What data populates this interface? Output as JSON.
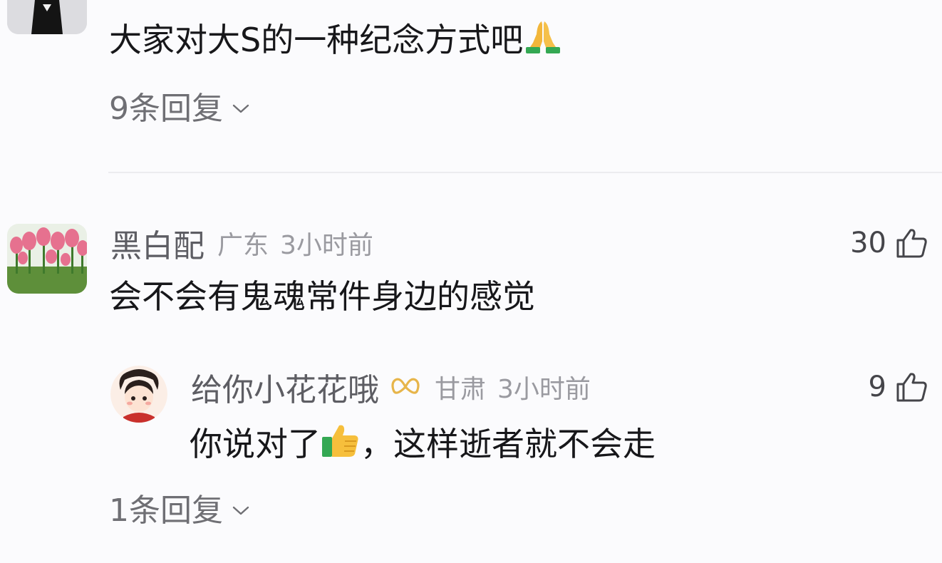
{
  "thread": {
    "top_comment": {
      "text": "大家对大S的一种纪念方式吧",
      "emoji_icon": "folded-hands-emoji",
      "reply_count_label": "9条回复"
    },
    "comment": {
      "username": "黑白配",
      "location": "广东",
      "time": "3小时前",
      "like_count": "30",
      "text": "会不会有鬼魂常件身边的感觉"
    },
    "reply": {
      "username": "给你小花花哦",
      "badge_icon": "infinity-badge-icon",
      "location": "甘肃",
      "time": "3小时前",
      "like_count": "9",
      "text_before": "你说对了",
      "emoji_icon": "thumbs-up-emoji",
      "text_after": "，这样逝者就不会走",
      "reply_count_label": "1条回复"
    }
  },
  "colors": {
    "background": "#fbfbfd",
    "text_primary": "#17171a",
    "text_secondary": "#5d5d63",
    "text_muted": "#9a9aa0",
    "badge_gold": "#e7b54a"
  }
}
